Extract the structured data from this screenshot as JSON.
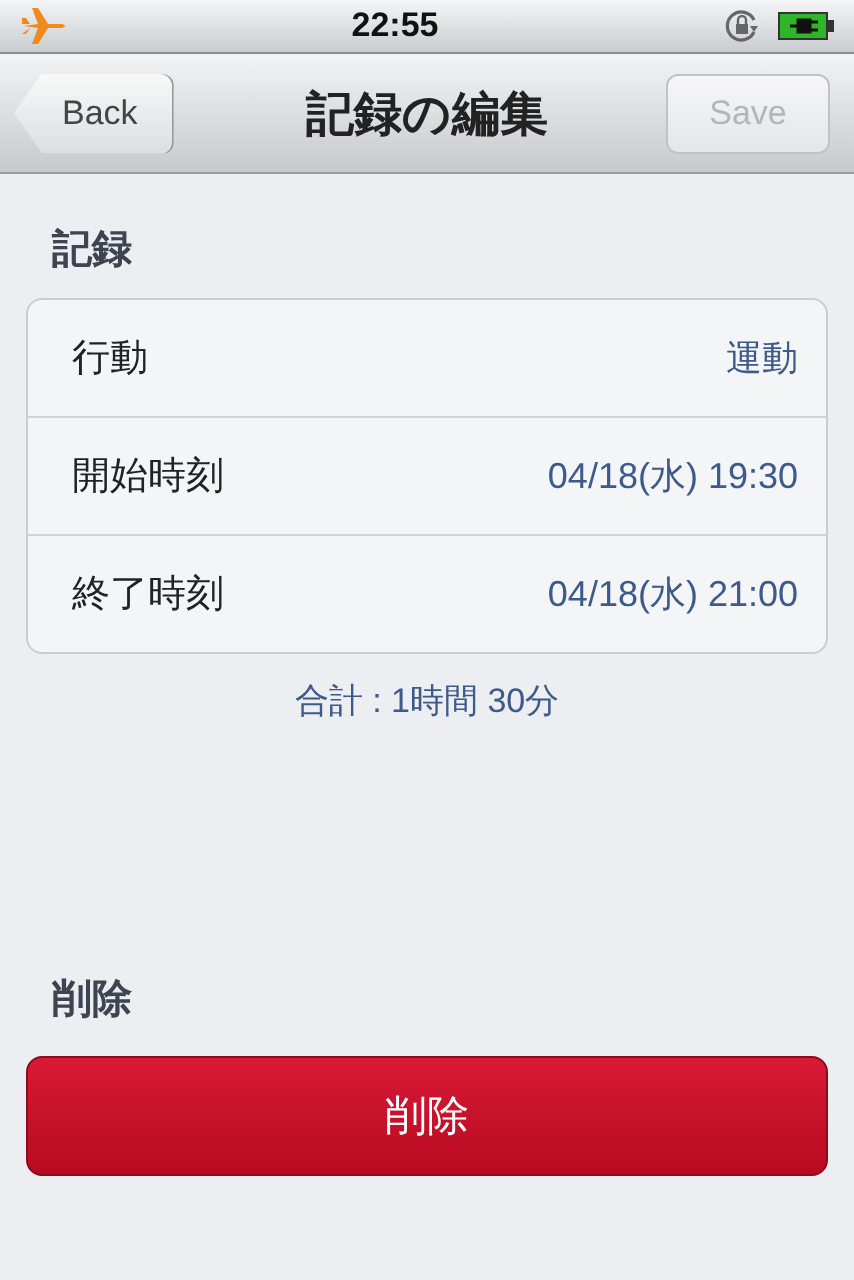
{
  "status_bar": {
    "time": "22:55"
  },
  "nav": {
    "back": "Back",
    "title": "記録の編集",
    "save": {
      "label": "Save",
      "disabled": true
    }
  },
  "record_section": {
    "header": "記録",
    "rows": [
      {
        "label": "行動",
        "value": "運動"
      },
      {
        "label": "開始時刻",
        "value": "04/18(水) 19:30"
      },
      {
        "label": "終了時刻",
        "value": "04/18(水) 21:00"
      }
    ],
    "total": "合計 : 1時間 30分"
  },
  "delete_section": {
    "header": "削除",
    "button": "削除"
  }
}
